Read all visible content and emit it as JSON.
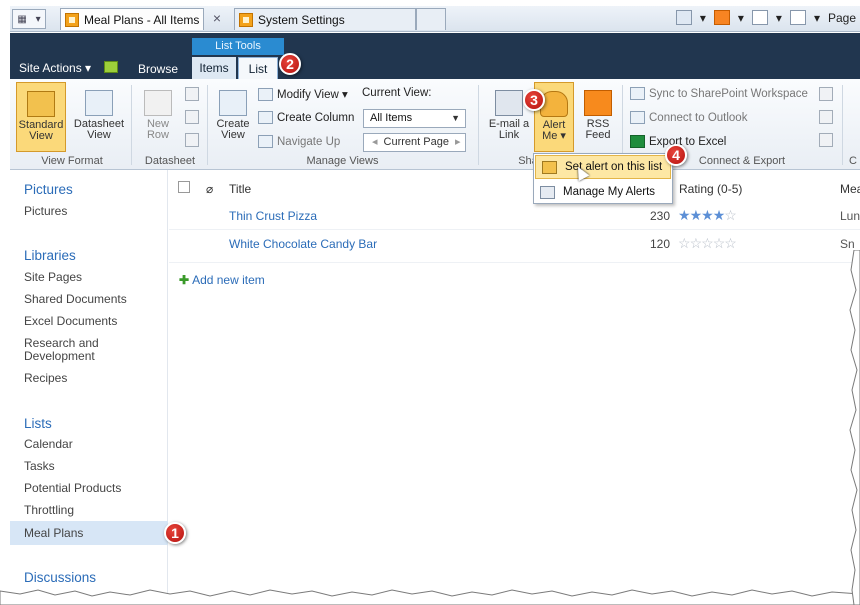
{
  "browser": {
    "tabs": [
      {
        "label": "Meal Plans - All Items",
        "close": "×"
      },
      {
        "label": "System Settings"
      }
    ],
    "toolbar_page": "Page"
  },
  "suite": {
    "list_tools": "List Tools",
    "site_actions": "Site Actions ▾",
    "browse": "Browse",
    "tab_items": "Items",
    "tab_list": "List"
  },
  "ribbon": {
    "standard_view": [
      "Standard",
      "View"
    ],
    "datasheet_view": [
      "Datasheet",
      "View"
    ],
    "new_row": [
      "New",
      "Row"
    ],
    "create_view": [
      "Create",
      "View"
    ],
    "modify_view": "Modify View ▾",
    "create_column": "Create Column",
    "navigate_up": "Navigate Up",
    "current_view_label": "Current View:",
    "current_view_value": "All Items",
    "current_page": "Current Page",
    "email_link": [
      "E-mail a",
      "Link"
    ],
    "alert_me": [
      "Alert",
      "Me ▾"
    ],
    "rss_feed": [
      "RSS",
      "Feed"
    ],
    "sync_workspace": "Sync to SharePoint Workspace",
    "connect_outlook": "Connect to Outlook",
    "export_excel": "Export to Excel",
    "groups": {
      "view_format": "View Format",
      "datasheet": "Datasheet",
      "manage_views": "Manage Views",
      "share": "Sha",
      "connect_export": "Connect & Export",
      "c": "C"
    }
  },
  "alert_menu": {
    "set_alert": "Set alert on this list",
    "manage_alerts": "Manage My Alerts"
  },
  "quick_launch": {
    "pictures_head": "Pictures",
    "pictures": [
      "Pictures"
    ],
    "libraries_head": "Libraries",
    "libraries": [
      "Site Pages",
      "Shared Documents",
      "Excel Documents",
      "Research and Development",
      "Recipes"
    ],
    "lists_head": "Lists",
    "lists": [
      "Calendar",
      "Tasks",
      "Potential Products",
      "Throttling",
      "Meal Plans"
    ],
    "discussions_head": "Discussions"
  },
  "list": {
    "columns": {
      "title": "Title",
      "rating": "Rating (0-5)",
      "meal": "Mea"
    },
    "rows": [
      {
        "title": "Thin Crust Pizza",
        "count": "230",
        "rating": 4,
        "meal": "Lun"
      },
      {
        "title": "White Chocolate Candy Bar",
        "count": "120",
        "rating": 0,
        "meal": "Sn"
      }
    ],
    "add_new": "Add new item"
  },
  "callouts": [
    "1",
    "2",
    "3",
    "4"
  ],
  "colors": {
    "suite_bar": "#21364f",
    "list_tools": "#2a8bd1",
    "link": "#2b6cb8",
    "callout": "#c4201a"
  }
}
